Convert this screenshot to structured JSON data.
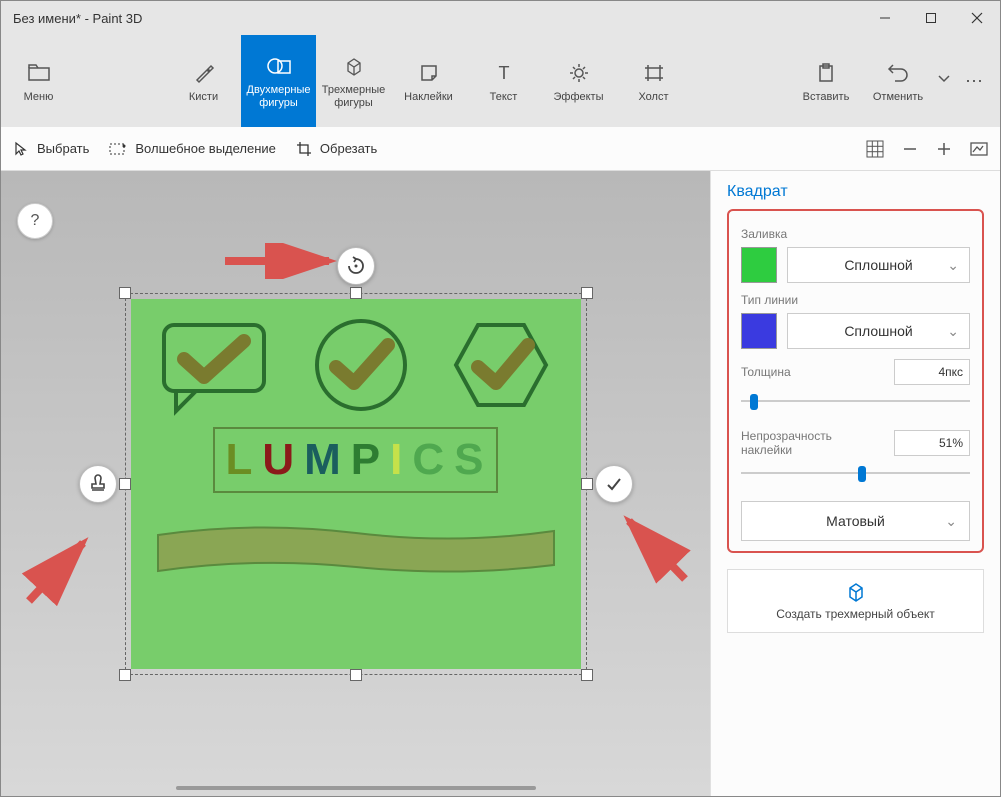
{
  "title": "Без имени* - Paint 3D",
  "ribbon": {
    "menu": "Меню",
    "brushes": "Кисти",
    "shapes2d": "Двухмерные фигуры",
    "shapes3d": "Трехмерные фигуры",
    "stickers": "Наклейки",
    "text": "Текст",
    "effects": "Эффекты",
    "canvas": "Холст",
    "paste": "Вставить",
    "undo": "Отменить"
  },
  "toolbar2": {
    "select": "Выбрать",
    "magic": "Волшебное выделение",
    "crop": "Обрезать"
  },
  "sidebar": {
    "title": "Квадрат",
    "fill_label": "Заливка",
    "fill_type": "Сплошной",
    "line_label": "Тип линии",
    "line_type": "Сплошной",
    "thickness_label": "Толщина",
    "thickness_value": "4пкс",
    "opacity_label": "Непрозрачность наклейки",
    "opacity_value": "51%",
    "material": "Матовый",
    "create3d": "Создать трехмерный объект"
  },
  "colors": {
    "fill": "#2ecc40",
    "line": "#3a3ae0"
  },
  "canvas_text": {
    "l": "L",
    "u": "U",
    "m": "M",
    "p": "P",
    "i": "I",
    "c": "C",
    "s": "S"
  },
  "help": "?"
}
